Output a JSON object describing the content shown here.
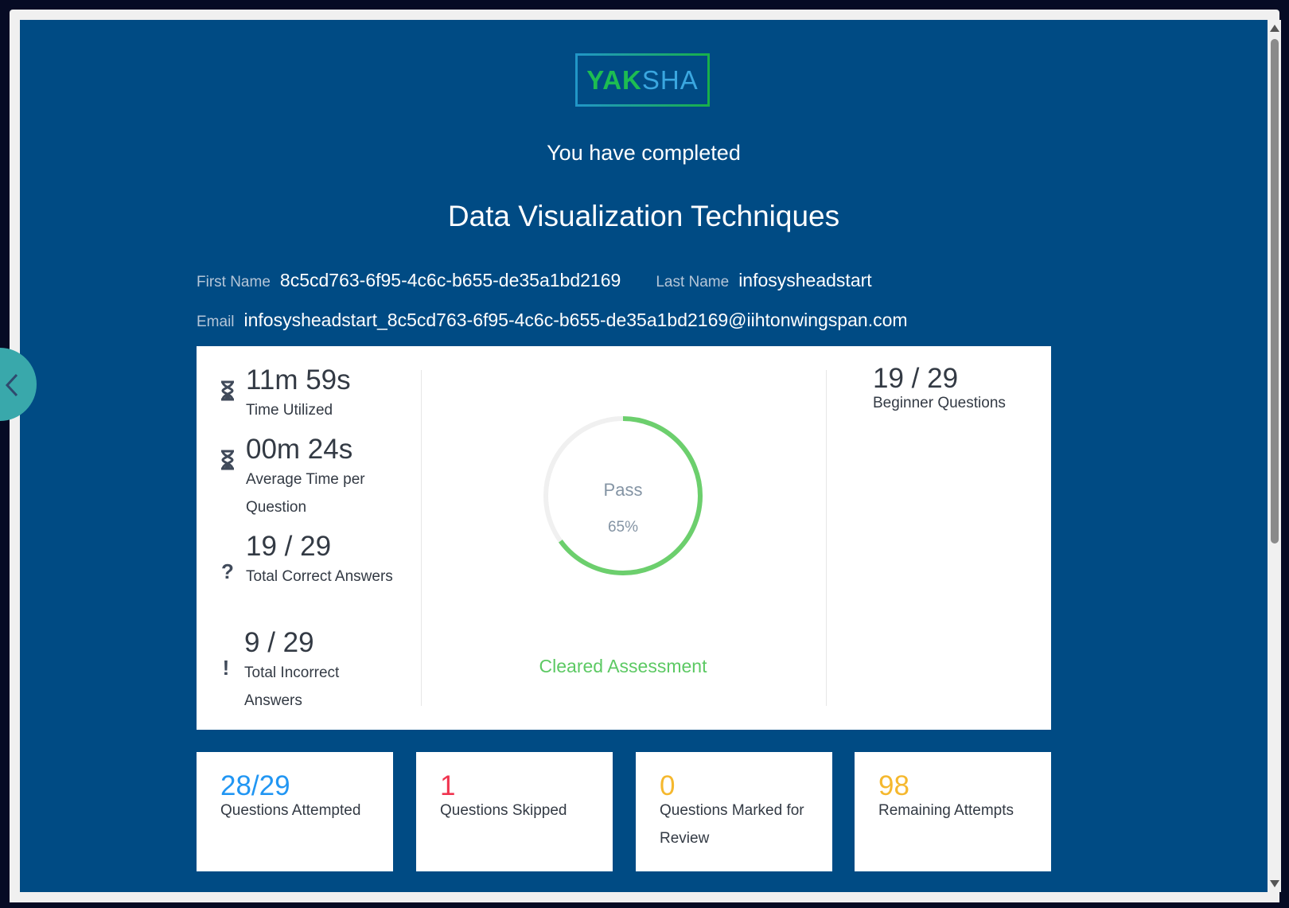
{
  "brand": {
    "part1": "YAK",
    "part2": "SHA"
  },
  "header": {
    "completed_text": "You have completed",
    "assessment_title": "Data Visualization Techniques"
  },
  "candidate": {
    "first_name_label": "First Name",
    "first_name_value": "8c5cd763-6f95-4c6c-b655-de35a1bd2169",
    "last_name_label": "Last Name",
    "last_name_value": "infosysheadstart",
    "email_label": "Email",
    "email_value": "infosysheadstart_8c5cd763-6f95-4c6c-b655-de35a1bd2169@iihtonwingspan.com"
  },
  "stats": [
    {
      "icon": "hourglass-icon",
      "value": "11m 59s",
      "label": "Time Utilized"
    },
    {
      "icon": "hourglass-icon",
      "value": "00m 24s",
      "label": "Average Time per Question"
    },
    {
      "icon": "question-icon",
      "value": "19 / 29",
      "label": "Total Correct Answers"
    },
    {
      "icon": "exclamation-icon",
      "value": "9 / 29",
      "label": "Total Incorrect Answers"
    }
  ],
  "result": {
    "status": "Pass",
    "percent_text": "65%",
    "percent": 65,
    "cleared_text": "Cleared Assessment"
  },
  "level_stats": {
    "value": "19 / 29",
    "label": "Beginner Questions"
  },
  "summary_cards": [
    {
      "value": "28/29",
      "label": "Questions Attempted",
      "color": "#2196f3"
    },
    {
      "value": "1",
      "label": "Questions Skipped",
      "color": "#f0344f"
    },
    {
      "value": "0",
      "label": "Questions Marked for Review",
      "color": "#f5b82e"
    },
    {
      "value": "98",
      "label": "Remaining Attempts",
      "color": "#f5b82e"
    }
  ],
  "colors": {
    "background": "#004b84",
    "pass_green": "#6ccf6d",
    "ring_track": "#f0f0f0"
  }
}
